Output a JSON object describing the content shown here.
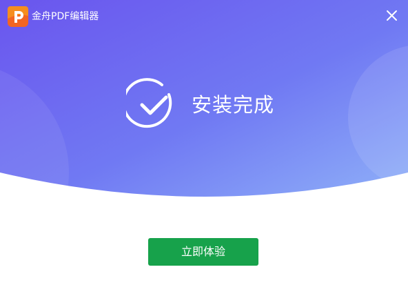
{
  "window": {
    "title": "金舟PDF编辑器",
    "close_glyph": "✕",
    "logo_icon": "pdf-editor-logo-icon"
  },
  "status": {
    "icon": "check-circle-icon",
    "message": "安装完成"
  },
  "actions": {
    "primary_label": "立即体验"
  },
  "colors": {
    "hero_gradient_start": "#6b5cf0",
    "hero_gradient_end": "#8aa8f8",
    "primary_button": "#17a24b",
    "logo_orange": "#f26522",
    "text_on_hero": "#ffffff"
  }
}
